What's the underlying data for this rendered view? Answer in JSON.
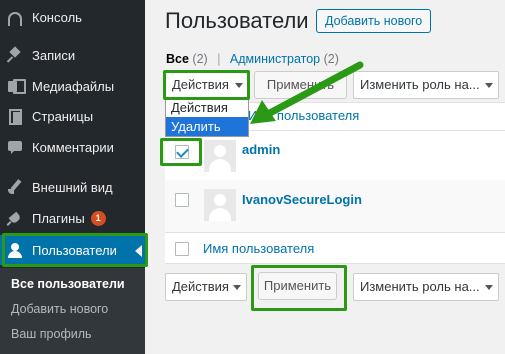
{
  "sidebar": {
    "items": [
      {
        "label": "Консоль"
      },
      {
        "label": "Записи"
      },
      {
        "label": "Медиафайлы"
      },
      {
        "label": "Страницы"
      },
      {
        "label": "Комментарии"
      },
      {
        "label": "Внешний вид"
      },
      {
        "label": "Плагины",
        "badge": "1"
      },
      {
        "label": "Пользователи"
      }
    ],
    "submenu": [
      {
        "label": "Все пользователи"
      },
      {
        "label": "Добавить нового"
      },
      {
        "label": "Ваш профиль"
      }
    ]
  },
  "header": {
    "title": "Пользователи",
    "add_new": "Добавить нового"
  },
  "views": {
    "all_label": "Все",
    "all_count": "(2)",
    "admin_label": "Администратор",
    "admin_count": "(2)",
    "separator": "|"
  },
  "bulk_top": {
    "action_value": "Действия",
    "apply_label": "Применить",
    "role_value": "Изменить роль на..."
  },
  "bulk_dropdown": {
    "options": [
      "Действия",
      "Удалить"
    ],
    "selected": "Удалить"
  },
  "table": {
    "column_username": "Имя пользователя",
    "rows": [
      {
        "username": "admin",
        "checked": true
      },
      {
        "username": "IvanovSecureLogin",
        "checked": false
      }
    ]
  },
  "bulk_bottom": {
    "action_value": "Действия",
    "apply_label": "Применить",
    "role_value": "Изменить роль на..."
  },
  "colors": {
    "sidebar_bg": "#23282d",
    "active_bg": "#0073aa",
    "highlight": "#2a9a16",
    "link": "#0073aa",
    "selected_option": "#1e74d9",
    "badge": "#d54e21"
  }
}
